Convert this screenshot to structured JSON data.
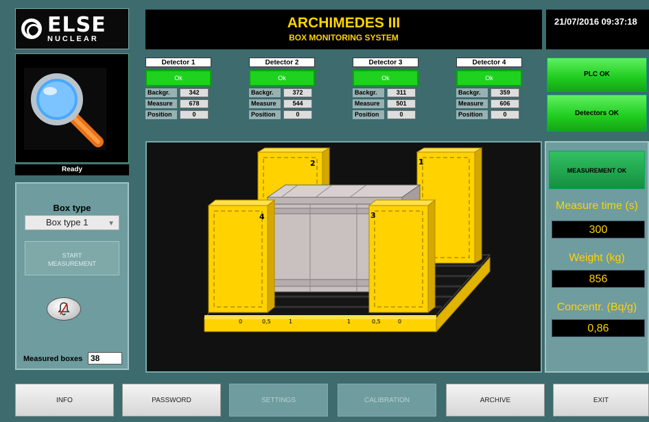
{
  "header": {
    "logo_big": "ELSE",
    "logo_small": "NUCLEAR",
    "title": "ARCHIMEDES III",
    "subtitle": "BOX MONITORING SYSTEM",
    "datetime": "21/07/2016 09:37:18"
  },
  "status": {
    "ready": "Ready",
    "plc": "PLC OK",
    "detectors": "Detectors OK",
    "measurement": "MEASUREMENT OK"
  },
  "detectors": [
    {
      "name": "Detector 1",
      "state": "Ok",
      "backgr": "342",
      "measure": "678",
      "position": "0"
    },
    {
      "name": "Detector 2",
      "state": "Ok",
      "backgr": "372",
      "measure": "544",
      "position": "0"
    },
    {
      "name": "Detector 3",
      "state": "Ok",
      "backgr": "311",
      "measure": "501",
      "position": "0"
    },
    {
      "name": "Detector 4",
      "state": "Ok",
      "backgr": "359",
      "measure": "606",
      "position": "0"
    }
  ],
  "labels": {
    "backgr": "Backgr.",
    "measure": "Measure",
    "position": "Position"
  },
  "left": {
    "box_type_label": "Box type",
    "box_type_value": "Box type 1",
    "start_line1": "START",
    "start_line2": "MEASUREMENT",
    "measured_label": "Measured boxes",
    "measured_value": "38"
  },
  "right": {
    "measure_time_label": "Measure time (s)",
    "measure_time_value": "300",
    "weight_label": "Weight (kg)",
    "weight_value": "856",
    "concentr_label": "Concentr. (Bq/g)",
    "concentr_value": "0,86"
  },
  "viz": {
    "detector_numbers": [
      "1",
      "2",
      "3",
      "4"
    ],
    "scale_left": [
      "0",
      "0,5",
      "1"
    ],
    "scale_right": [
      "1",
      "0,5",
      "0"
    ]
  },
  "footer": [
    {
      "label": "INFO",
      "enabled": true
    },
    {
      "label": "PASSWORD",
      "enabled": true
    },
    {
      "label": "SETTINGS",
      "enabled": false
    },
    {
      "label": "CALIBRATION",
      "enabled": false
    },
    {
      "label": "ARCHIVE",
      "enabled": true
    },
    {
      "label": "EXIT",
      "enabled": true
    }
  ],
  "colors": {
    "accent_yellow": "#ffd400",
    "ok_green": "#1fd21f",
    "background": "#3d6b6e"
  }
}
